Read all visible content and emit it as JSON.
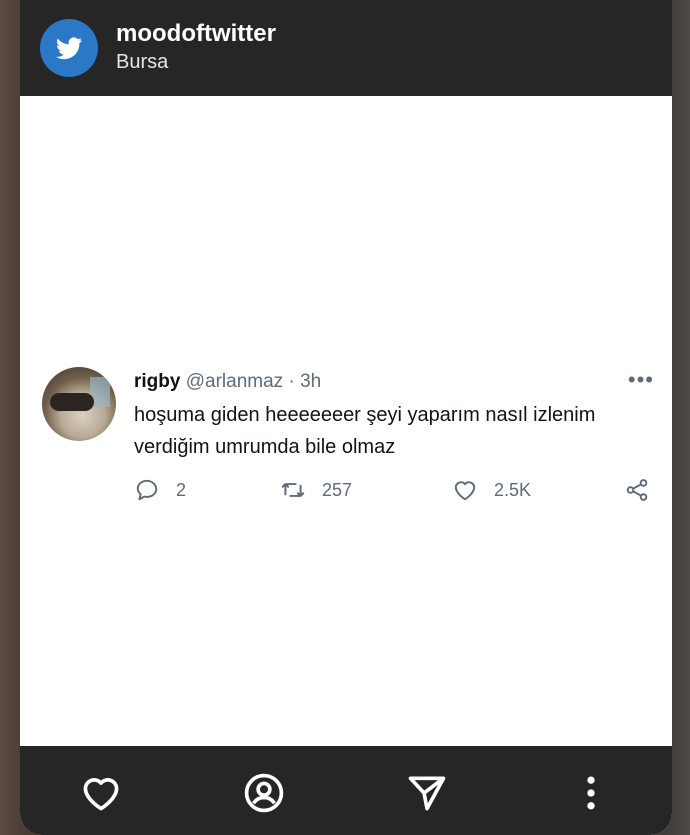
{
  "header": {
    "account_name": "moodoftwitter",
    "location": "Bursa",
    "avatar_icon": "twitter-bird-icon",
    "avatar_color": "#2b78c6"
  },
  "tweet": {
    "display_name": "rigby",
    "handle": "@arlanmaz",
    "separator": "·",
    "time": "3h",
    "more_label": "•••",
    "text": "hoşuma giden heeeeeeer şeyi yaparım nasıl izlenim verdiğim umrumda bile olmaz",
    "replies": "2",
    "retweets": "257",
    "likes": "2.5K"
  },
  "bottom_nav": {
    "items": [
      "heart-icon",
      "profile-icon",
      "send-icon",
      "more-vertical-icon"
    ]
  },
  "colors": {
    "bar": "#262626",
    "muted_text": "#5f6b76",
    "text": "#0f1419"
  }
}
